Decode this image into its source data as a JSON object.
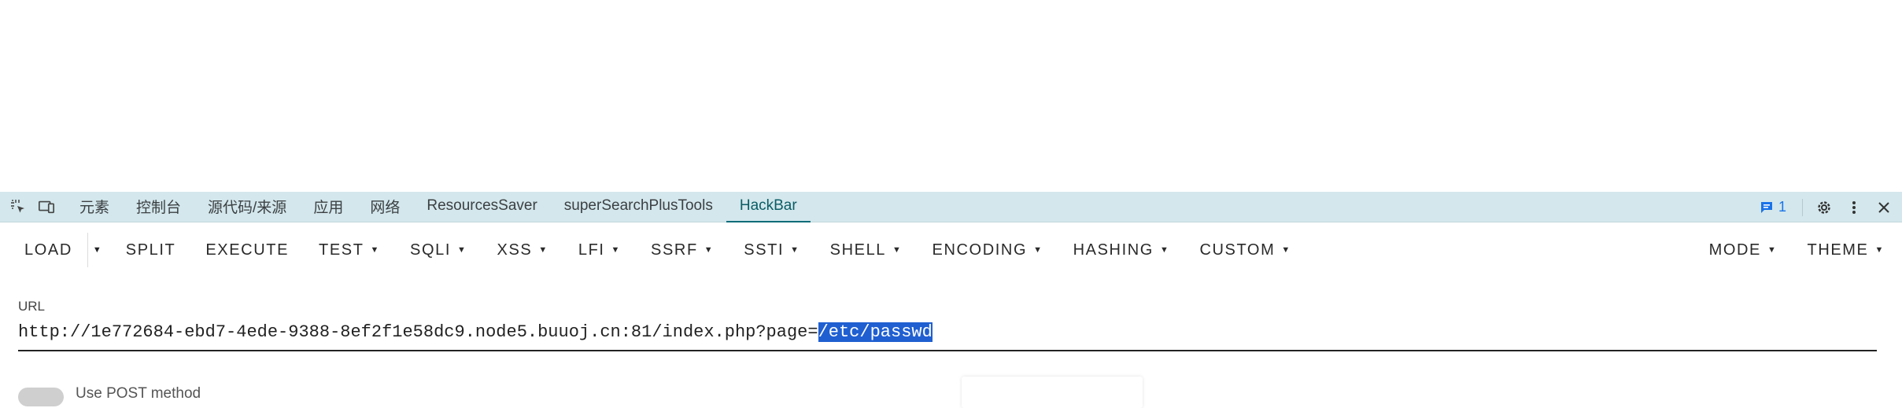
{
  "devtools": {
    "tabs": [
      "元素",
      "控制台",
      "源代码/来源",
      "应用",
      "网络",
      "ResourcesSaver",
      "superSearchPlusTools",
      "HackBar"
    ],
    "active_tab": "HackBar",
    "issues_count": "1"
  },
  "hackbar": {
    "toolbar": {
      "load": "LOAD",
      "split": "SPLIT",
      "execute": "EXECUTE",
      "test": "TEST",
      "sqli": "SQLI",
      "xss": "XSS",
      "lfi": "LFI",
      "ssrf": "SSRF",
      "ssti": "SSTI",
      "shell": "SHELL",
      "encoding": "ENCODING",
      "hashing": "HASHING",
      "custom": "CUSTOM",
      "mode": "MODE",
      "theme": "THEME"
    },
    "url_label": "URL",
    "url_prefix": "http://1e772684-ebd7-4ede-9388-8ef2f1e58dc9.node5.buuoj.cn:81/index.php?page=",
    "url_selected": "/etc/passwd",
    "post_label": "Use POST method"
  },
  "colors": {
    "devbar_bg": "#d3e7ec",
    "active_tab": "#0b5d66",
    "selection": "#1f5fd1"
  }
}
